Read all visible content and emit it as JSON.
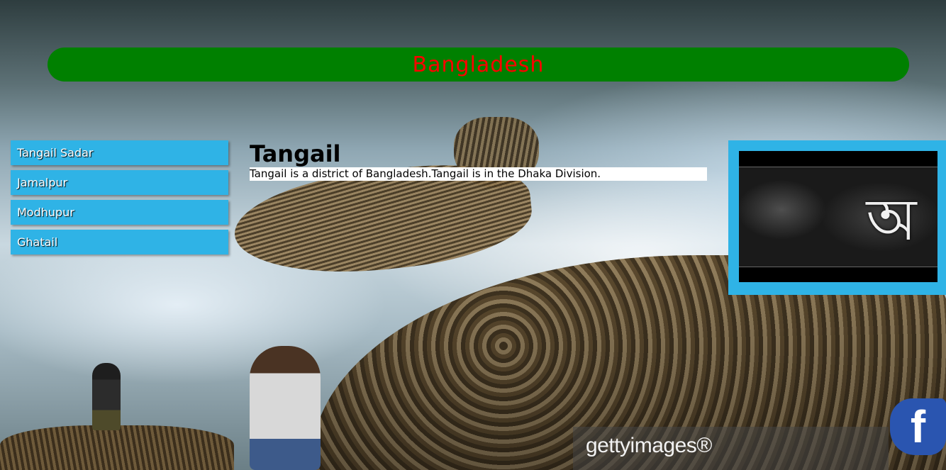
{
  "header": {
    "title": "Bangladesh"
  },
  "sidebar": {
    "items": [
      {
        "label": "Tangail Sadar"
      },
      {
        "label": "Jamalpur"
      },
      {
        "label": "Modhupur"
      },
      {
        "label": "Ghatail"
      }
    ]
  },
  "main": {
    "title": "Tangail",
    "description": "Tangail is a district of Bangladesh.Tangail is in the Dhaka Division."
  },
  "side_image": {
    "glyph": "অ"
  },
  "background": {
    "watermark": "gettyimages®"
  },
  "social": {
    "facebook_icon": "f"
  },
  "colors": {
    "header_bg": "#008000",
    "header_text": "#ff0000",
    "nav_bg": "#2fb3e6",
    "panel_bg": "#2fb3e6"
  }
}
